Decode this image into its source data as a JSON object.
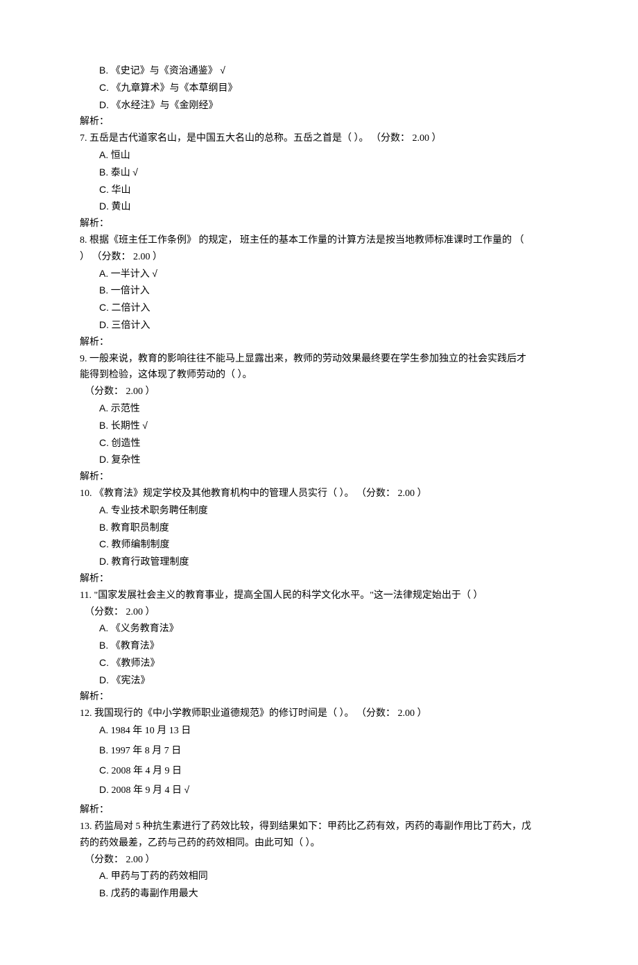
{
  "q6": {
    "options": {
      "b": "《史记》与《资治通鉴》",
      "c": "《九章算术》与《本草纲目》",
      "d": "《水经注》与《金刚经》"
    },
    "correct_mark_b": "√"
  },
  "q7": {
    "stem": "7. 五岳是古代道家名山，是中国五大名山的总称。五岳之首是（ ）。",
    "score": "（分数： 2.00 ）",
    "options": {
      "a": "恒山",
      "b": "泰山",
      "c": "华山",
      "d": "黄山"
    },
    "correct_mark_b": "√"
  },
  "q8": {
    "stem_line1": "8. 根据《班主任工作条例》 的规定， 班主任的基本工作量的计算方法是按当地教师标准课时工作量的 （",
    "stem_line2": "）",
    "score": "（分数： 2.00 ）",
    "options": {
      "a": "一半计入",
      "b": "一倍计入",
      "c": "二倍计入",
      "d": "三倍计入"
    },
    "correct_mark_a": "√"
  },
  "q9": {
    "stem_line1": "9. 一般来说，教育的影响往往不能马上显露出来，教师的劳动效果最终要在学生参加独立的社会实践后才",
    "stem_line2": "能得到检验，这体现了教师劳动的（ ）。",
    "score": "（分数： 2.00 ）",
    "options": {
      "a": "示范性",
      "b": "长期性",
      "c": "创造性",
      "d": "复杂性"
    },
    "correct_mark_b": "√"
  },
  "q10": {
    "stem": "10.  《教育法》规定学校及其他教育机构中的管理人员实行（ ）。",
    "score": "（分数： 2.00 ）",
    "options": {
      "a": "专业技术职务聘任制度",
      "b": "教育职员制度",
      "c": "教师编制制度",
      "d": "教育行政管理制度"
    }
  },
  "q11": {
    "stem": "11.  \"国家发展社会主义的教育事业，提高全国人民的科学文化水平。\"这一法律规定始出于（ ）",
    "score": "（分数： 2.00 ）",
    "options": {
      "a": "《义务教育法》",
      "b": "《教育法》",
      "c": "《教师法》",
      "d": "《宪法》"
    }
  },
  "q12": {
    "stem": "12.  我国现行的《中小学教师职业道德规范》的修订时间是（ ）。",
    "score": "（分数： 2.00 ）",
    "options": {
      "a": "1984 年 10 月 13 日",
      "b": "1997 年 8 月 7 日",
      "c": "2008 年 4 月 9 日",
      "d": "2008 年 9 月 4 日"
    },
    "correct_mark_d": "√"
  },
  "q13": {
    "stem_line1": "13.  药监局对 5 种抗生素进行了药效比较，得到结果如下：甲药比乙药有效，丙药的毒副作用比丁药大，戊",
    "stem_line2": "药的药效最差，乙药与己药的药效相同。由此可知（ ）。",
    "score": "（分数： 2.00 ）",
    "options": {
      "a": "甲药与丁药的药效相同",
      "b": "戊药的毒副作用最大"
    }
  },
  "labels": {
    "A": "A.",
    "B": "B.",
    "C": "C.",
    "D": "D.",
    "analysis": "解析："
  }
}
